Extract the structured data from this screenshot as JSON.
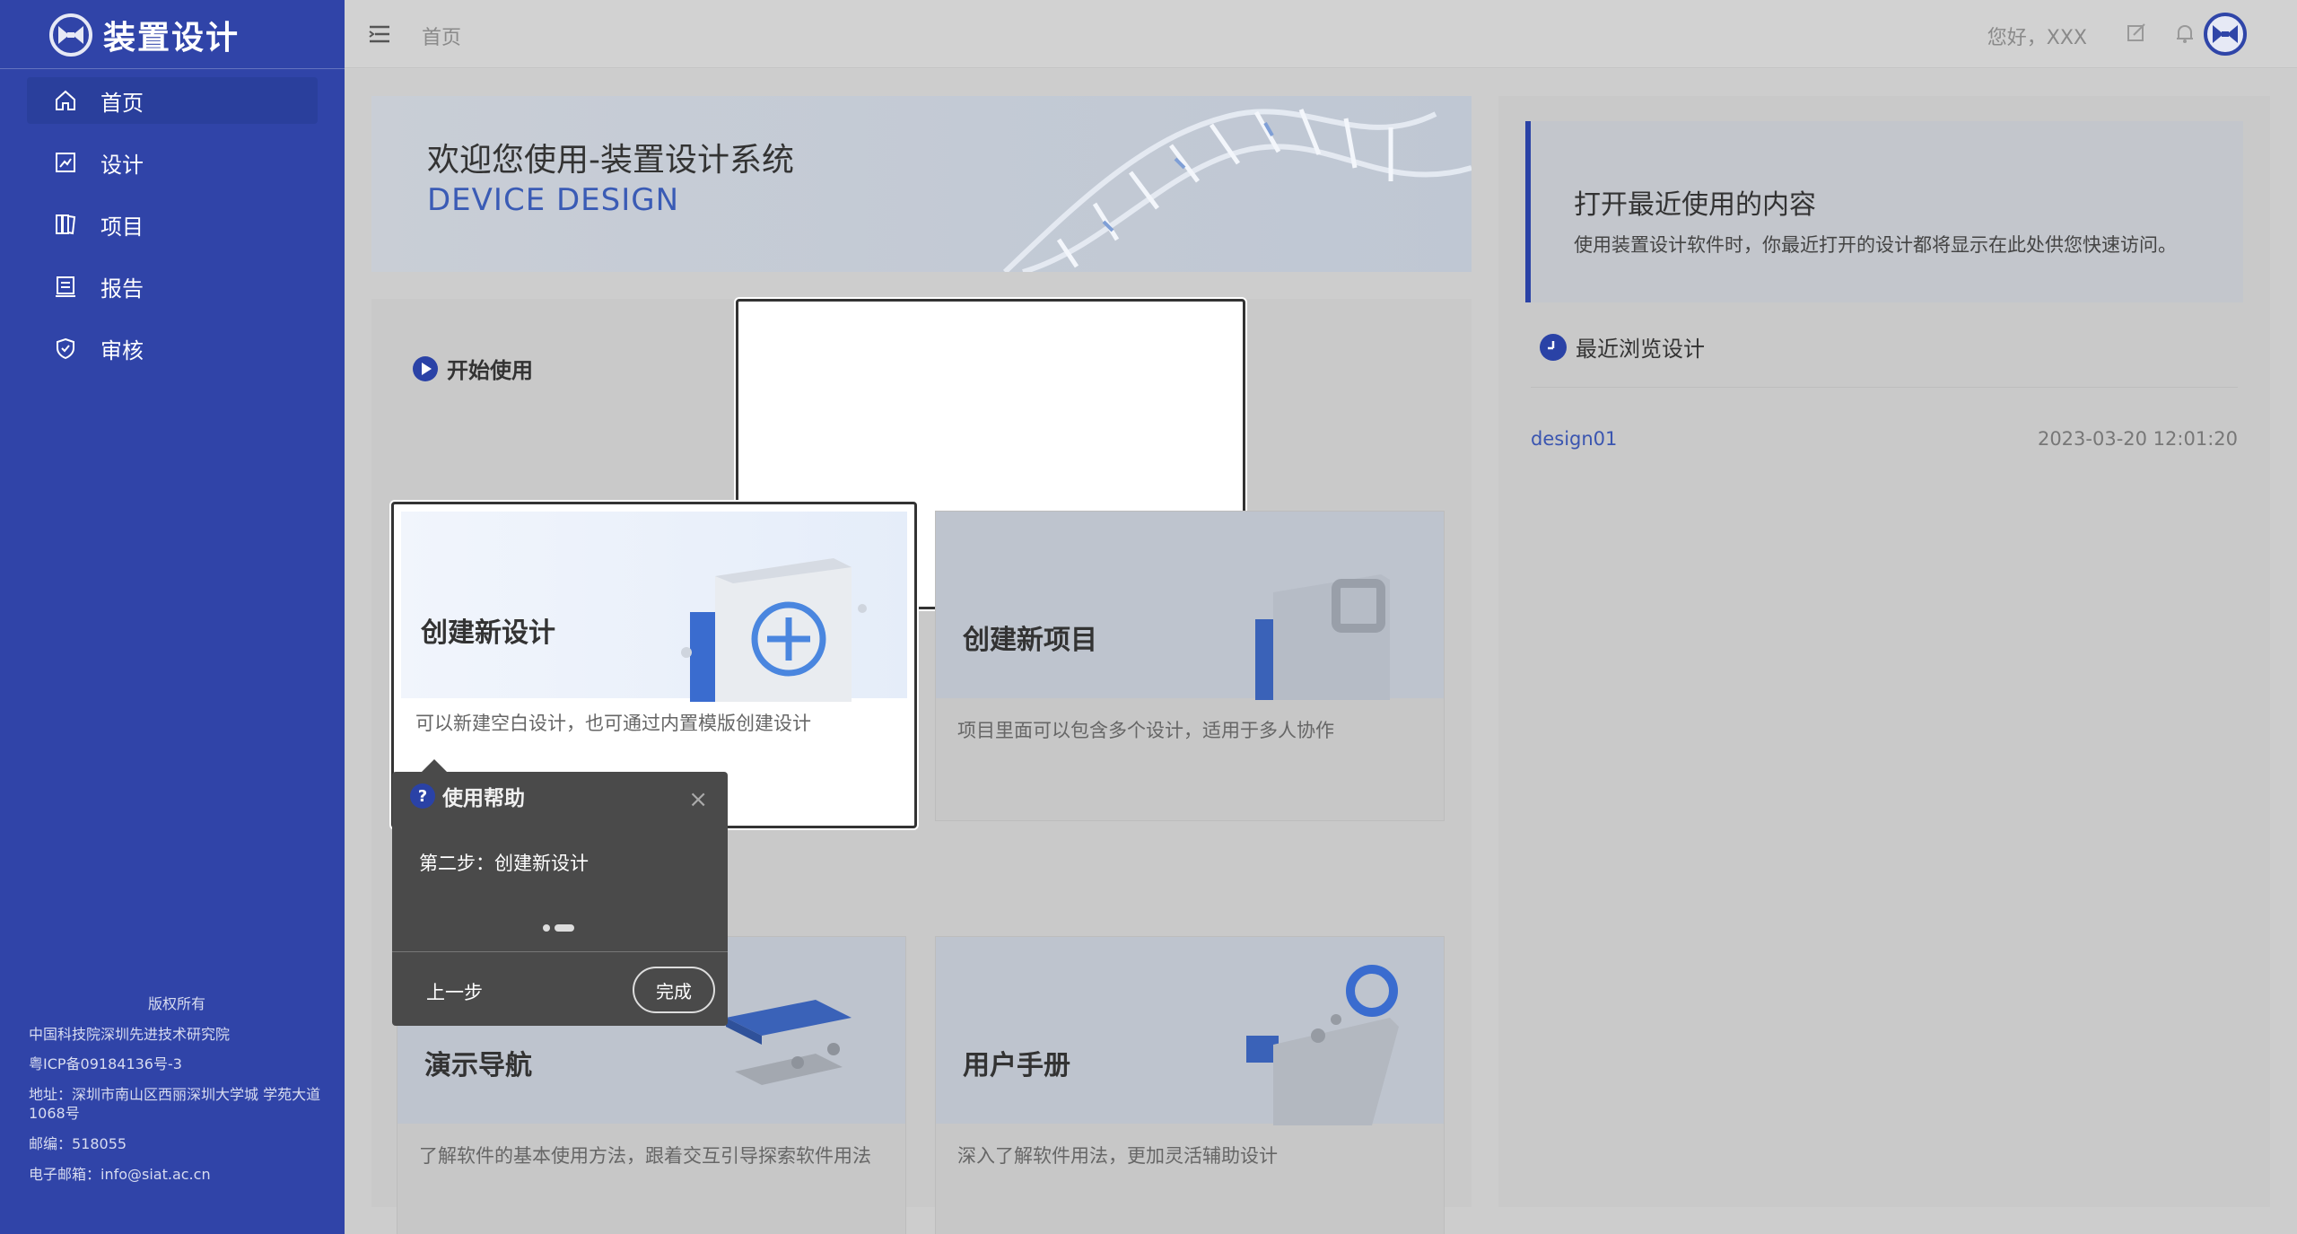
{
  "app": {
    "title": "装置设计"
  },
  "sidebar": {
    "items": [
      {
        "label": "首页",
        "icon": "home-icon",
        "active": true
      },
      {
        "label": "设计",
        "icon": "design-icon"
      },
      {
        "label": "项目",
        "icon": "project-icon"
      },
      {
        "label": "报告",
        "icon": "report-icon"
      },
      {
        "label": "审核",
        "icon": "audit-shield-icon"
      }
    ],
    "footer": {
      "copyright": "版权所有",
      "org": "中国科技院深圳先进技术研究院",
      "icp": "粤ICP备09184136号-3",
      "address": "地址：深圳市南山区西丽深圳大学城 学苑大道1068号",
      "postcode": "邮编：518055",
      "email": "电子邮箱：info@siat.ac.cn"
    }
  },
  "header": {
    "breadcrumb": "首页",
    "greeting": "您好，XXX"
  },
  "banner": {
    "title": "欢迎您使用-装置设计系统",
    "subtitle": "DEVICE DESIGN"
  },
  "start": {
    "heading": "开始使用",
    "cards": [
      {
        "title": "创建新设计",
        "desc": "可以新建空白设计，也可通过内置模版创建设计"
      },
      {
        "title": "创建新项目",
        "desc": "项目里面可以包含多个设计，适用于多人协作"
      },
      {
        "title": "演示导航",
        "desc": "了解软件的基本使用方法，跟着交互引导探索软件用法"
      },
      {
        "title": "用户手册",
        "desc": "深入了解软件用法，更加灵活辅助设计"
      }
    ]
  },
  "recent": {
    "title": "打开最近使用的内容",
    "desc": "使用装置设计软件时，你最近打开的设计都将显示在此处供您快速访问。",
    "browse_heading": "最近浏览设计",
    "items": [
      {
        "name": "design01",
        "time": "2023-03-20 12:01:20"
      }
    ]
  },
  "help_popover": {
    "title": "使用帮助",
    "step_text": "第二步：创建新设计",
    "prev_label": "上一步",
    "done_label": "完成",
    "close_glyph": "×"
  },
  "colors": {
    "sidebar": "#3044a8",
    "accent": "#2a42a6",
    "link": "#3a55b0"
  }
}
